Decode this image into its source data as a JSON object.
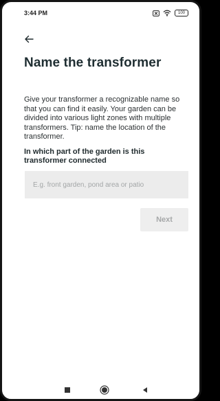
{
  "status_bar": {
    "time": "3:44 PM",
    "battery": "100",
    "icons": [
      "close-box-icon",
      "wifi-icon",
      "battery-icon"
    ]
  },
  "header": {
    "back_icon": "arrow-left-icon",
    "title": "Name the transformer"
  },
  "content": {
    "description": "Give your transformer a recognizable name so that you can find it easily. Your garden can be divided into various light zones with multiple transformers. Tip: name the location of the transformer.",
    "question": "In which part of the garden is this transformer connected",
    "input": {
      "value": "",
      "placeholder": "E.g. front garden, pond area or patio"
    },
    "next_label": "Next"
  },
  "nav_bar": {
    "icons": [
      "recents-icon",
      "home-icon",
      "back-icon"
    ]
  },
  "colors": {
    "text": "#1f2a2d",
    "input_bg": "#ececec",
    "button_bg": "#eeeeee",
    "button_text": "#a6a8a9"
  }
}
